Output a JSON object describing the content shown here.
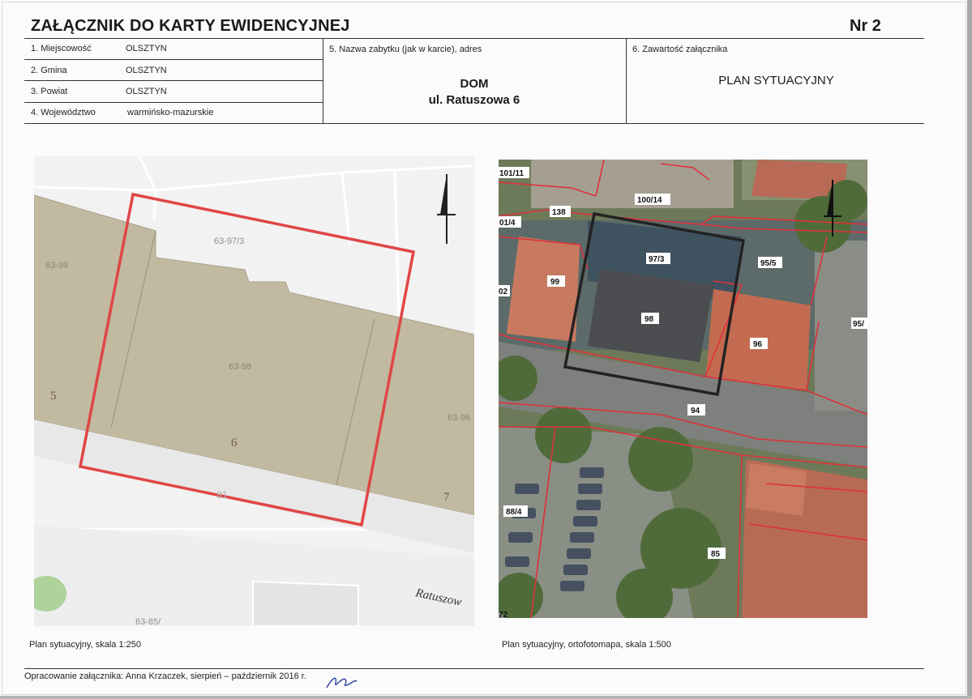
{
  "header": {
    "title": "ZAŁĄCZNIK DO KARTY EWIDENCYJNEJ",
    "number": "Nr 2"
  },
  "location": {
    "rows": [
      {
        "label": "1. Miejscowość",
        "value": "OLSZTYN"
      },
      {
        "label": "2. Gmina",
        "value": "OLSZTYN"
      },
      {
        "label": "3. Powiat",
        "value": "OLSZTYN"
      },
      {
        "label": "4. Województwo",
        "value": "warmińsko-mazurskie"
      }
    ]
  },
  "monument": {
    "label": "5. Nazwa zabytku (jak w karcie), adres",
    "name": "DOM",
    "address": "ul. Ratuszowa 6"
  },
  "attachment": {
    "label": "6. Zawartość załącznika",
    "content": "PLAN SYTUACYJNY"
  },
  "map_left": {
    "parcels": {
      "p63_97_3": "63-97/3",
      "p63_99": "63-99",
      "p63_98": "63-98",
      "p63_96": "63-96",
      "p63_85": "63-85/"
    },
    "numbers": {
      "n5": "5",
      "n6": "6",
      "n7": "7",
      "n81": "81"
    },
    "street": "Ratuszow",
    "caption": "Plan sytuacyjny, skala 1:250",
    "colors": {
      "built": "#c2b9a1",
      "frame": "#e04646"
    }
  },
  "map_right": {
    "labels": {
      "l101_11": "101/11",
      "l101_4": "01/4",
      "l100_14": "100/14",
      "l138": "138",
      "l97_3": "97/3",
      "l95_5": "95/5",
      "l99": "99",
      "l02": "02",
      "l98": "98",
      "l96": "96",
      "l95": "95/",
      "l94": "94",
      "l88_4": "88/4",
      "l85": "85",
      "l72": "72"
    },
    "caption": "Plan sytuacyjny, ortofotomapa, skala 1:500",
    "colors": {
      "frame": "#222222",
      "parcel": "#e0303a"
    }
  },
  "footer": {
    "prepared_by": "Opracowanie załącznika: Anna Krzaczek, sierpień – październik 2016 r."
  }
}
